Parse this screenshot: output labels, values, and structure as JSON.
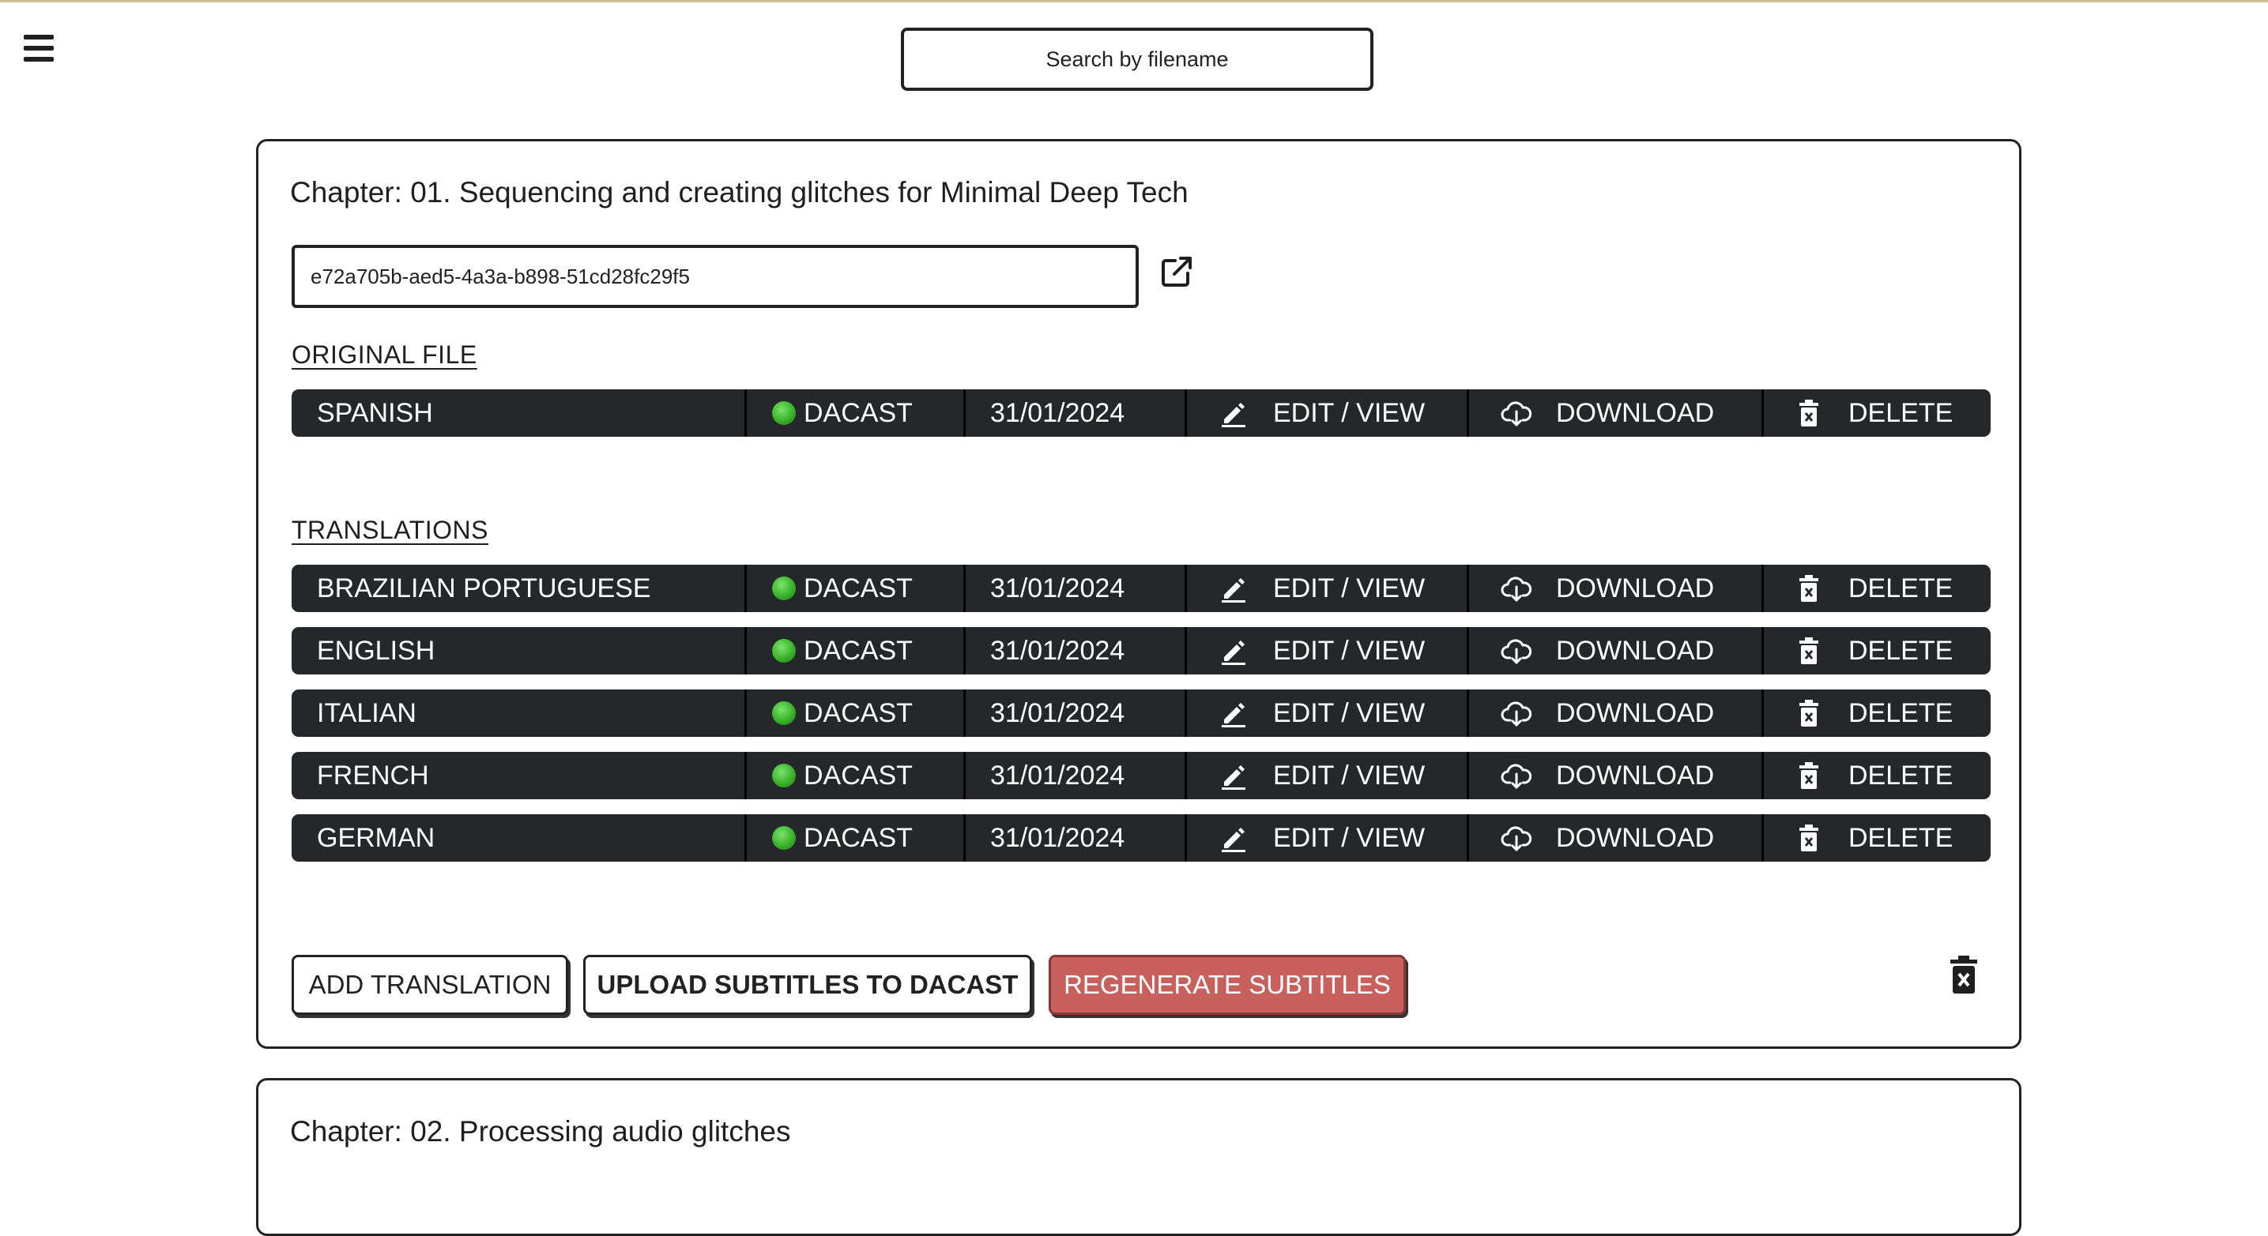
{
  "search": {
    "placeholder": "Search by filename"
  },
  "chapters": [
    {
      "title": "Chapter: 01. Sequencing and creating glitches for Minimal Deep Tech",
      "video_id": "e72a705b-aed5-4a3a-b898-51cd28fc29f5",
      "original_label": "ORIGINAL FILE",
      "translations_label": "TRANSLATIONS",
      "original": {
        "language": "SPANISH",
        "source": "DACAST",
        "date": "31/01/2024"
      },
      "translations": [
        {
          "language": "BRAZILIAN PORTUGUESE",
          "source": "DACAST",
          "date": "31/01/2024"
        },
        {
          "language": "ENGLISH",
          "source": "DACAST",
          "date": "31/01/2024"
        },
        {
          "language": "ITALIAN",
          "source": "DACAST",
          "date": "31/01/2024"
        },
        {
          "language": "FRENCH",
          "source": "DACAST",
          "date": "31/01/2024"
        },
        {
          "language": "GERMAN",
          "source": "DACAST",
          "date": "31/01/2024"
        }
      ],
      "buttons": {
        "add_translation": "ADD TRANSLATION",
        "upload_subtitles": "UPLOAD SUBTITLES TO DACAST",
        "regenerate_subtitles": "REGENERATE SUBTITLES"
      }
    },
    {
      "title": "Chapter: 02. Processing audio glitches"
    }
  ],
  "row_actions": {
    "edit": "EDIT / VIEW",
    "download": "DOWNLOAD",
    "delete": "DELETE"
  },
  "colors": {
    "row_background": "#25272b",
    "status_dot": "#39b22a",
    "regenerate_button": "#c8615e",
    "border": "#222222"
  },
  "icons": {
    "menu": "hamburger-icon",
    "open_external": "external-link-icon",
    "edit": "pencil-icon",
    "download": "cloud-download-icon",
    "delete": "trash-icon"
  }
}
